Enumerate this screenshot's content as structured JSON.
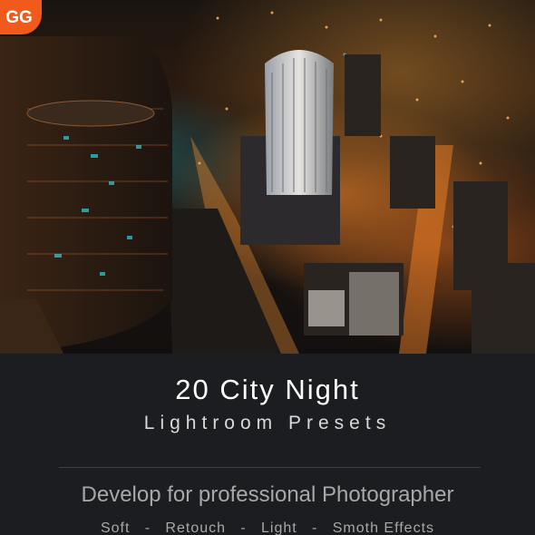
{
  "brand": {
    "logo_text": "GG",
    "accent_color": "#f05a1a"
  },
  "hero": {
    "description_kind": "city-night-aerial-photo"
  },
  "product": {
    "title": "20 City Night",
    "subtitle": "Lightroom Presets",
    "tagline": "Develop for professional Photographer",
    "effects": [
      "Soft",
      "Retouch",
      "Light",
      "Smoth Effects"
    ],
    "effects_separator": "-"
  },
  "colors": {
    "panel_background": "#1c1d20",
    "title_color": "#ffffff",
    "muted_text": "#a8a8a8"
  }
}
